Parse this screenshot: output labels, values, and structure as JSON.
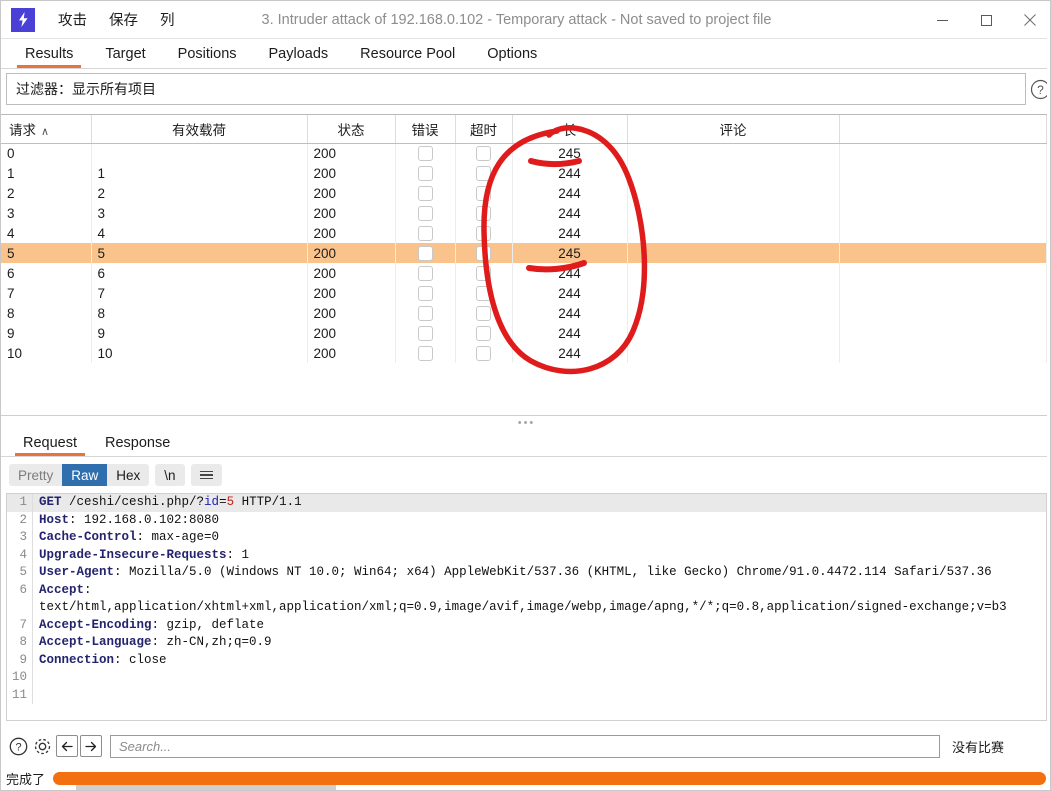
{
  "window": {
    "title": "3. Intruder attack of 192.168.0.102 - Temporary attack - Not saved to project file",
    "logo_icon": "lightning-bolt-icon",
    "minimize_label": "–",
    "maximize_label": "□",
    "close_label": "✕"
  },
  "menubar": {
    "items": [
      {
        "label": "攻击"
      },
      {
        "label": "保存"
      },
      {
        "label": "列"
      }
    ]
  },
  "top_tabs": {
    "items": [
      {
        "label": "Results",
        "active": true
      },
      {
        "label": "Target",
        "active": false
      },
      {
        "label": "Positions",
        "active": false
      },
      {
        "label": "Payloads",
        "active": false
      },
      {
        "label": "Resource Pool",
        "active": false
      },
      {
        "label": "Options",
        "active": false
      }
    ]
  },
  "filter": {
    "text": "过滤器：显示所有项目",
    "help_icon": "question-mark-icon"
  },
  "results_table": {
    "columns": [
      {
        "label": "请求",
        "sort": "∧"
      },
      {
        "label": "有效载荷",
        "sort": ""
      },
      {
        "label": "状态",
        "sort": ""
      },
      {
        "label": "错误",
        "sort": ""
      },
      {
        "label": "超时",
        "sort": ""
      },
      {
        "label": "长",
        "sort": ""
      },
      {
        "label": "评论",
        "sort": ""
      }
    ],
    "rows": [
      {
        "request": "0",
        "payload": "",
        "status": "200",
        "error": false,
        "timeout": false,
        "length": "245",
        "comment": "",
        "selected": false
      },
      {
        "request": "1",
        "payload": "1",
        "status": "200",
        "error": false,
        "timeout": false,
        "length": "244",
        "comment": "",
        "selected": false
      },
      {
        "request": "2",
        "payload": "2",
        "status": "200",
        "error": false,
        "timeout": false,
        "length": "244",
        "comment": "",
        "selected": false
      },
      {
        "request": "3",
        "payload": "3",
        "status": "200",
        "error": false,
        "timeout": false,
        "length": "244",
        "comment": "",
        "selected": false
      },
      {
        "request": "4",
        "payload": "4",
        "status": "200",
        "error": false,
        "timeout": false,
        "length": "244",
        "comment": "",
        "selected": false
      },
      {
        "request": "5",
        "payload": "5",
        "status": "200",
        "error": false,
        "timeout": false,
        "length": "245",
        "comment": "",
        "selected": true
      },
      {
        "request": "6",
        "payload": "6",
        "status": "200",
        "error": false,
        "timeout": false,
        "length": "244",
        "comment": "",
        "selected": false
      },
      {
        "request": "7",
        "payload": "7",
        "status": "200",
        "error": false,
        "timeout": false,
        "length": "244",
        "comment": "",
        "selected": false
      },
      {
        "request": "8",
        "payload": "8",
        "status": "200",
        "error": false,
        "timeout": false,
        "length": "244",
        "comment": "",
        "selected": false
      },
      {
        "request": "9",
        "payload": "9",
        "status": "200",
        "error": false,
        "timeout": false,
        "length": "244",
        "comment": "",
        "selected": false
      },
      {
        "request": "10",
        "payload": "10",
        "status": "200",
        "error": false,
        "timeout": false,
        "length": "244",
        "comment": "",
        "selected": false
      }
    ]
  },
  "annotation": {
    "color": "#e01b1b",
    "shape": "hand-drawn-oval-around-length-column",
    "underlines": 2
  },
  "splitter": {
    "dots": "•••"
  },
  "message_tabs": {
    "items": [
      {
        "label": "Request",
        "active": true
      },
      {
        "label": "Response",
        "active": false
      }
    ]
  },
  "view_modes": {
    "buttons": [
      {
        "label": "Pretty",
        "active": false,
        "muted": true
      },
      {
        "label": "Raw",
        "active": true,
        "muted": false
      },
      {
        "label": "Hex",
        "active": false,
        "muted": false
      }
    ],
    "newline_label": "\\n",
    "menu_icon": "hamburger-menu-icon"
  },
  "request_code": {
    "lines": [
      {
        "no": "1",
        "highlight": true,
        "segments": [
          {
            "t": "GET",
            "c": "kw"
          },
          {
            "t": " /ceshi/ceshi.php/?",
            "c": ""
          },
          {
            "t": "id",
            "c": "pk"
          },
          {
            "t": "=",
            "c": ""
          },
          {
            "t": "5",
            "c": "pv"
          },
          {
            "t": " HTTP/1.1",
            "c": ""
          }
        ]
      },
      {
        "no": "2",
        "highlight": false,
        "segments": [
          {
            "t": "Host",
            "c": "kw"
          },
          {
            "t": ": 192.168.0.102:8080",
            "c": ""
          }
        ]
      },
      {
        "no": "3",
        "highlight": false,
        "segments": [
          {
            "t": "Cache-Control",
            "c": "kw"
          },
          {
            "t": ": max-age=0",
            "c": ""
          }
        ]
      },
      {
        "no": "4",
        "highlight": false,
        "segments": [
          {
            "t": "Upgrade-Insecure-Requests",
            "c": "kw"
          },
          {
            "t": ": 1",
            "c": ""
          }
        ]
      },
      {
        "no": "5",
        "highlight": false,
        "segments": [
          {
            "t": "User-Agent",
            "c": "kw"
          },
          {
            "t": ": Mozilla/5.0 (Windows NT 10.0; Win64; x64) AppleWebKit/537.36 (KHTML, like Gecko) Chrome/91.0.4472.114 Safari/537.36",
            "c": ""
          }
        ]
      },
      {
        "no": "6",
        "highlight": false,
        "segments": [
          {
            "t": "Accept",
            "c": "kw"
          },
          {
            "t": ":",
            "c": ""
          }
        ]
      },
      {
        "no": "",
        "highlight": false,
        "segments": [
          {
            "t": "text/html,application/xhtml+xml,application/xml;q=0.9,image/avif,image/webp,image/apng,*/*;q=0.8,application/signed-exchange;v=b3",
            "c": ""
          }
        ]
      },
      {
        "no": "7",
        "highlight": false,
        "segments": [
          {
            "t": "Accept-Encoding",
            "c": "kw"
          },
          {
            "t": ": gzip, deflate",
            "c": ""
          }
        ]
      },
      {
        "no": "8",
        "highlight": false,
        "segments": [
          {
            "t": "Accept-Language",
            "c": "kw"
          },
          {
            "t": ": zh-CN,zh;q=0.9",
            "c": ""
          }
        ]
      },
      {
        "no": "9",
        "highlight": false,
        "segments": [
          {
            "t": "Connection",
            "c": "kw"
          },
          {
            "t": ": close",
            "c": ""
          }
        ]
      },
      {
        "no": "10",
        "highlight": false,
        "segments": [
          {
            "t": "",
            "c": ""
          }
        ]
      },
      {
        "no": "11",
        "highlight": false,
        "segments": [
          {
            "t": "",
            "c": ""
          }
        ]
      }
    ]
  },
  "bottom_bar": {
    "help_icon": "question-mark-icon",
    "settings_icon": "gear-icon",
    "back_icon": "arrow-left-icon",
    "forward_icon": "arrow-right-icon",
    "search_placeholder": "Search...",
    "search_value": "",
    "match_status": "没有比赛"
  },
  "status_bar": {
    "text": "完成了",
    "progress_percent": 100,
    "progress_color": "#f2700f"
  }
}
